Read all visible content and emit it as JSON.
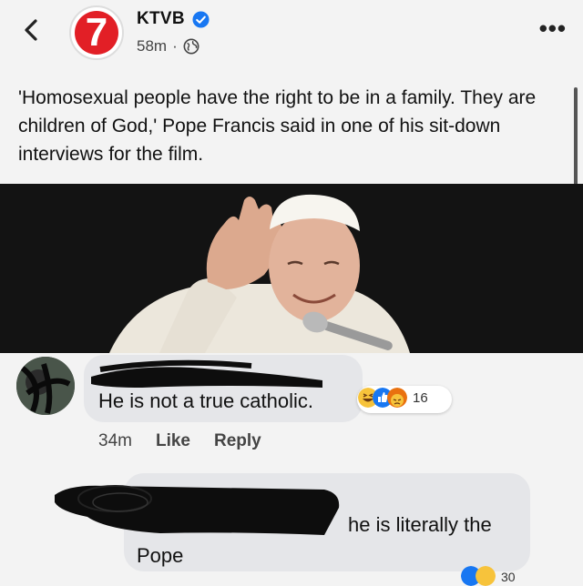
{
  "header": {
    "page_name": "KTVB",
    "time": "58m",
    "logo_text": "7"
  },
  "post": {
    "text": "'Homosexual people have the right to be in a family. They are children of God,' Pope Francis said in one of his sit-down interviews for the film."
  },
  "comments": [
    {
      "text": "He is not a true catholic.",
      "reaction_count": "16",
      "time": "34m",
      "like_label": "Like",
      "reply_label": "Reply"
    },
    {
      "text": "he is literally the Pope",
      "reaction_count": "30"
    }
  ],
  "colors": {
    "logo_red": "#e21f26",
    "verified_blue": "#1877f2",
    "bubble": "#e5e6e9"
  }
}
